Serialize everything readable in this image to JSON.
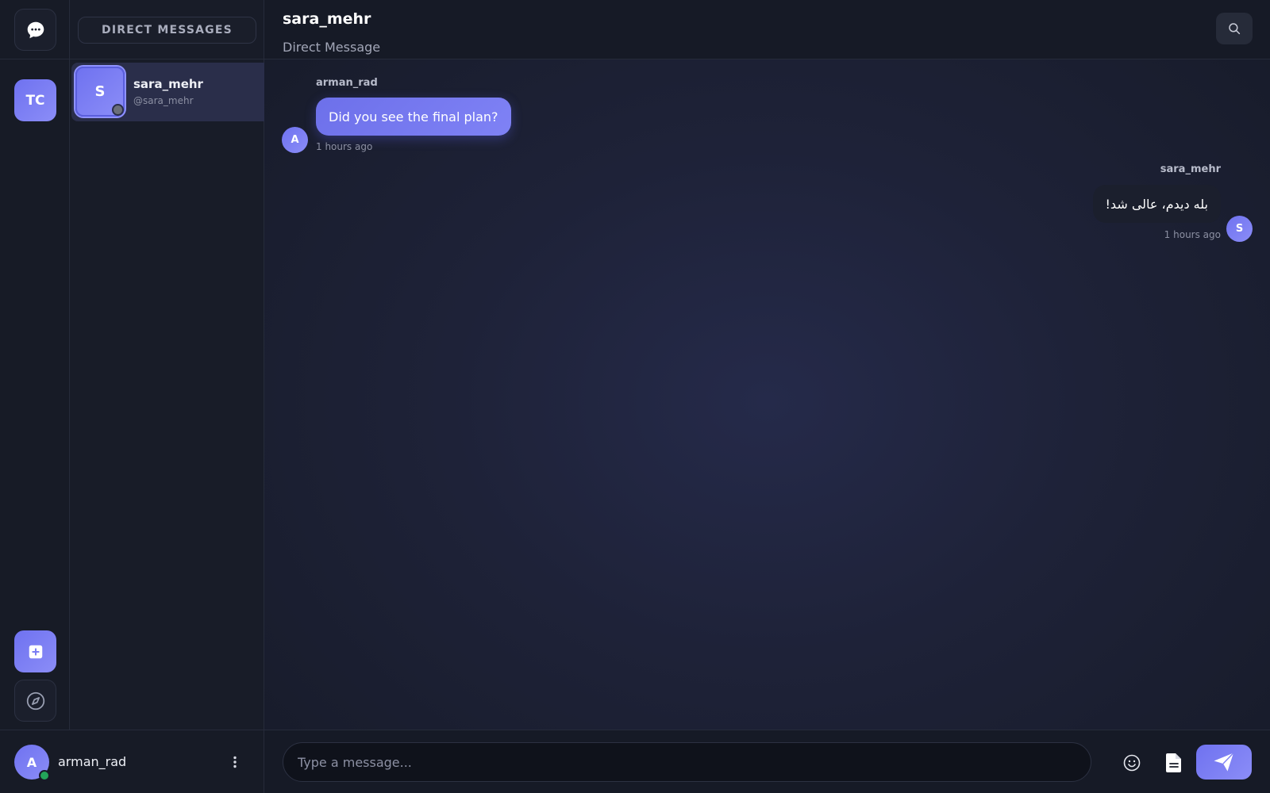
{
  "rail": {
    "server_initials": "TC"
  },
  "dm_panel": {
    "title": "DIRECT MESSAGES",
    "items": [
      {
        "initial": "S",
        "name": "sara_mehr",
        "handle": "@sara_mehr"
      }
    ]
  },
  "current_user": {
    "initial": "A",
    "name": "arman_rad"
  },
  "chat": {
    "title": "sara_mehr",
    "subtitle": "Direct Message",
    "messages": [
      {
        "author": "arman_rad",
        "initial": "A",
        "text": "Did you see the final plan?",
        "time": "1 hours ago"
      },
      {
        "author": "sara_mehr",
        "initial": "S",
        "text": "بله دیدم، عالی شد!",
        "time": "1 hours ago"
      }
    ]
  },
  "composer": {
    "placeholder": "Type a message..."
  },
  "icons": {
    "home": "chat-bubble-icon",
    "add": "plus-square-icon",
    "explore": "compass-icon",
    "search": "search-icon",
    "menu": "vertical-dots-icon",
    "emoji": "smiley-icon",
    "attach": "document-icon",
    "send": "paper-plane-icon"
  },
  "colors": {
    "accent": "#7174f0",
    "online": "#23a55a",
    "offline": "#6b6f7a"
  }
}
